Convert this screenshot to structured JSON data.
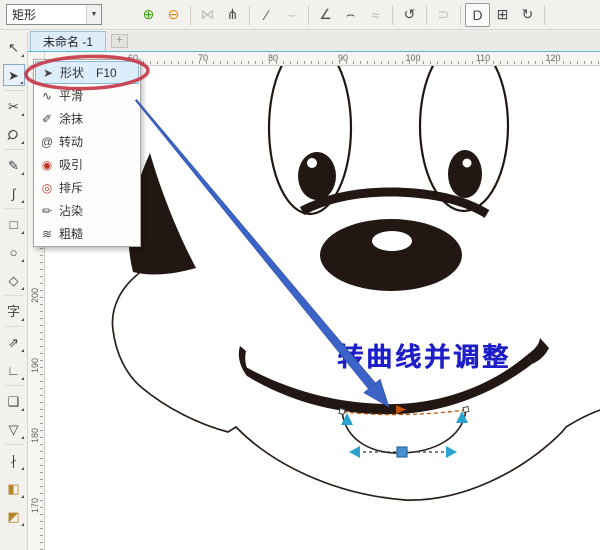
{
  "property_bar": {
    "preset_value": "矩形",
    "buttons": [
      {
        "name": "add-node-button",
        "icon": "add-node-icon",
        "enabled": true
      },
      {
        "name": "delete-node-button",
        "icon": "delete-node-icon",
        "enabled": true
      },
      {
        "type": "separator"
      },
      {
        "name": "join-nodes-button",
        "icon": "join-nodes-icon",
        "enabled": false
      },
      {
        "name": "break-curve-button",
        "icon": "break-curve-icon",
        "enabled": true
      },
      {
        "type": "separator"
      },
      {
        "name": "convert-to-line-button",
        "icon": "convert-line-icon",
        "enabled": true
      },
      {
        "name": "convert-to-curve-button",
        "icon": "convert-curve-icon",
        "enabled": false
      },
      {
        "type": "separator"
      },
      {
        "name": "cusp-node-button",
        "icon": "cusp-node-icon",
        "enabled": true
      },
      {
        "name": "smooth-node-button",
        "icon": "smooth-node-icon",
        "enabled": true
      },
      {
        "name": "symmetrical-node-button",
        "icon": "symmetric-node-icon",
        "enabled": false
      },
      {
        "type": "separator"
      },
      {
        "name": "reverse-direction-button",
        "icon": "reverse-direction-icon",
        "enabled": true
      },
      {
        "type": "separator"
      },
      {
        "name": "extend-curve-to-close-button",
        "icon": "extend-close-icon",
        "enabled": false
      },
      {
        "type": "separator"
      },
      {
        "name": "close-curve-button",
        "icon": "close-curve-icon",
        "enabled": true,
        "boxed": true
      },
      {
        "name": "select-all-nodes-button",
        "icon": "select-all-nodes-icon",
        "enabled": true
      },
      {
        "name": "rotate-skew-nodes-button",
        "icon": "rotate-skew-icon",
        "enabled": true
      },
      {
        "type": "separator"
      }
    ]
  },
  "tab_bar": {
    "tabs": [
      {
        "label": "未命名 -1",
        "active": true
      }
    ],
    "add_tab": "+"
  },
  "rulers": {
    "horizontal": [
      "60",
      "70",
      "80",
      "90",
      "100",
      "110",
      "120"
    ],
    "vertical": [
      "200",
      "190",
      "180",
      "170"
    ]
  },
  "toolbox": {
    "tools": [
      {
        "name": "pick-tool",
        "icon": "pick-tool-icon"
      },
      {
        "name": "shape-tool",
        "icon": "shape-tool-icon",
        "active": true
      },
      {
        "type": "separator"
      },
      {
        "name": "crop-tool",
        "icon": "crop-tool-icon"
      },
      {
        "name": "zoom-tool",
        "icon": "zoom-tool-icon"
      },
      {
        "type": "separator"
      },
      {
        "name": "freehand-tool",
        "icon": "freehand-tool-icon"
      },
      {
        "name": "artistic-media-tool",
        "icon": "artistic-media-icon"
      },
      {
        "type": "separator"
      },
      {
        "name": "rectangle-tool",
        "icon": "rectangle-tool-icon"
      },
      {
        "name": "ellipse-tool",
        "icon": "ellipse-tool-icon"
      },
      {
        "name": "polygon-tool",
        "icon": "polygon-tool-icon"
      },
      {
        "type": "separator"
      },
      {
        "name": "text-tool",
        "icon": "text-tool-icon"
      },
      {
        "type": "separator"
      },
      {
        "name": "dimension-tool",
        "icon": "dimension-tool-icon"
      },
      {
        "name": "connector-tool",
        "icon": "connector-tool-icon"
      },
      {
        "type": "separator"
      },
      {
        "name": "drop-shadow-tool",
        "icon": "drop-shadow-icon"
      },
      {
        "name": "transparency-tool",
        "icon": "transparency-tool-icon"
      },
      {
        "type": "separator"
      },
      {
        "name": "color-eyedropper-tool",
        "icon": "eyedropper-tool-icon"
      },
      {
        "name": "fill-tool",
        "icon": "fill-tool-icon"
      },
      {
        "name": "interactive-fill-tool",
        "icon": "interactive-fill-icon"
      }
    ]
  },
  "flyout_menu": {
    "items": [
      {
        "label": "形状",
        "shortcut": "F10",
        "icon": "shape-tool-icon",
        "active": true
      },
      {
        "label": "平滑",
        "icon": "smooth-brush-icon"
      },
      {
        "label": "涂抹",
        "icon": "smear-icon"
      },
      {
        "label": "转动",
        "icon": "twirl-icon"
      },
      {
        "label": "吸引",
        "icon": "attract-icon"
      },
      {
        "label": "排斥",
        "icon": "repel-icon"
      },
      {
        "label": "沾染",
        "icon": "smudge-icon"
      },
      {
        "label": "粗糙",
        "icon": "roughen-icon"
      }
    ]
  },
  "annotation": {
    "text": "转曲线并调整",
    "text_color": "#1e1ec8"
  },
  "colors": {
    "ink": "#221712",
    "arrow_blue": "#3c64c8",
    "ellipse_red": "#c5394a",
    "select_cyan": "#2aa2d0",
    "node_blue": "#4a90cf",
    "dash_orange": "#c55200"
  }
}
